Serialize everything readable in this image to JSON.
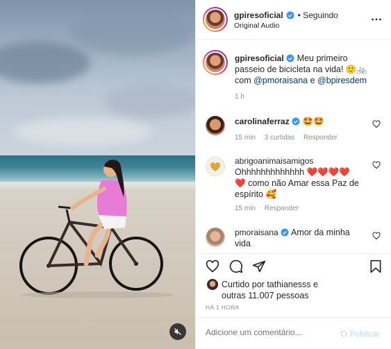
{
  "author": {
    "username": "gpiresoficial",
    "follow_status": "• Seguindo",
    "audio": "Original Audio"
  },
  "caption": {
    "username": "gpiresoficial",
    "line1": "Meu primeiro",
    "line2": "passeio de bicicleta na vida!",
    "emoji1": "🙂🚲",
    "with_prefix": "com",
    "mention1": "@pmoraisana",
    "joiner": "e",
    "mention2": "@bpiresdem",
    "time": "1 h"
  },
  "comments": [
    {
      "username": "carolinaferraz",
      "text": "🤩🤩",
      "time": "15 min",
      "likes": "3 curtidas",
      "reply": "Responder"
    },
    {
      "username": "abrigoanimaisamigos",
      "text_line1": "Ohhhhhhhhhhhhh",
      "hearts": "❤️❤️❤️❤️",
      "text_line2_heart": "❤️",
      "text_line2": "como não Amar essa Paz de",
      "text_line3": "espírito",
      "emoji": "🥰",
      "time": "15 min",
      "reply": "Responder"
    },
    {
      "username": "pmoraisana",
      "text": "Amor da minha",
      "text_line2": "vida"
    }
  ],
  "likes": {
    "liked_by_prefix": "Curtido por",
    "liked_by_user": "tathianesss",
    "liked_by_suffix": "e",
    "others": "outras 11.007 pessoas"
  },
  "timestamp": "HÁ 1 HORA",
  "add_comment": {
    "placeholder": "Adicione um comentário...",
    "publish": "Publicar"
  },
  "colors": {
    "verified": "#3897f0",
    "mention": "#00376b",
    "publish_disabled": "#b2dffc",
    "muted_text": "#8e8e8e"
  }
}
